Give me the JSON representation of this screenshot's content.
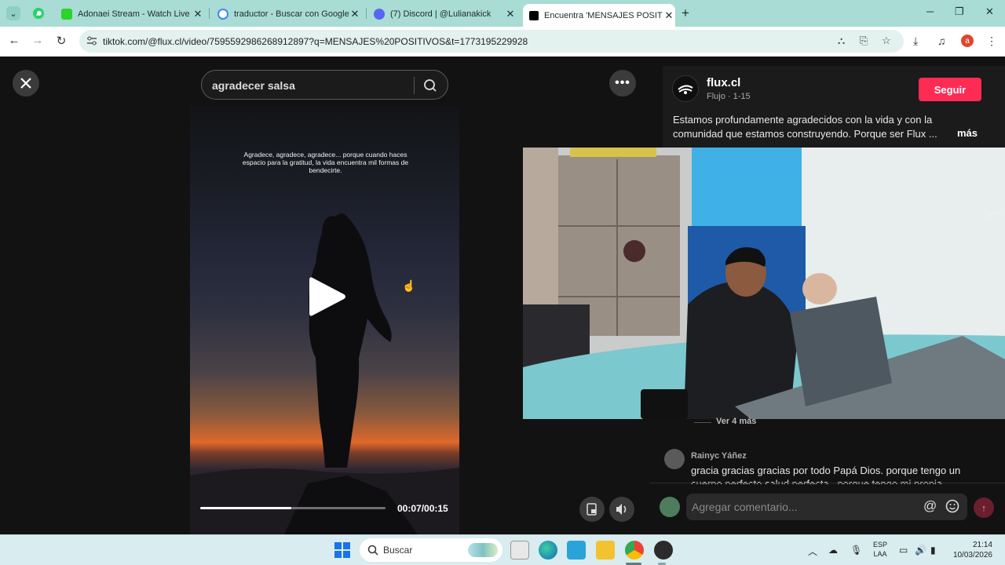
{
  "browser": {
    "tabs": [
      {
        "title": "Adonaei Stream - Watch Live o",
        "favicon_color": "#2bd32b",
        "close": "✕"
      },
      {
        "title": "traductor - Buscar con Google",
        "favicon_color": "#4285f4",
        "close": "✕"
      },
      {
        "title": "(7) Discord | @Lulianakick",
        "favicon_color": "#5865f2",
        "close": "✕"
      },
      {
        "title": "Encuentra 'MENSAJES POSITIVO",
        "favicon_color": "#000000",
        "close": "✕"
      }
    ],
    "active_tab_index": 3,
    "new_tab": "+",
    "url": "tiktok.com/@flux.cl/video/7595592986268912897?q=MENSAJES%20POSITIVOS&t=1773195229928",
    "profile_initial": "a"
  },
  "page": {
    "search_value": "agradecer salsa",
    "video": {
      "caption": "Agradece, agradece, agradece... porque cuando haces espacio para la gratitud, la vida encuentra mil formas de bendecirte.",
      "progress": 0.49,
      "time": "00:07/00:15"
    }
  },
  "panel": {
    "author": "flux.cl",
    "sub": "Flujo · 1-15",
    "follow_label": "Seguir",
    "description": "Estamos profundamente agradecidos con la vida y con la comunidad que estamos construyendo. Porque ser Flux ...",
    "description_more": "más",
    "ver_mas": "Ver 4 más",
    "comment": {
      "user": "Rainyc Yáñez",
      "text": "gracia gracias gracias por todo Papá Dios. porque tengo un cuerpo perfecto salud perfecta , porque tengo mi propia"
    },
    "comment_placeholder": "Agregar comentario...",
    "accent": "#fe2c55"
  },
  "taskbar": {
    "search_label": "Buscar",
    "lang_line1": "ESP",
    "lang_line2": "LAA",
    "time": "21:14",
    "date": "10/03/2026"
  }
}
